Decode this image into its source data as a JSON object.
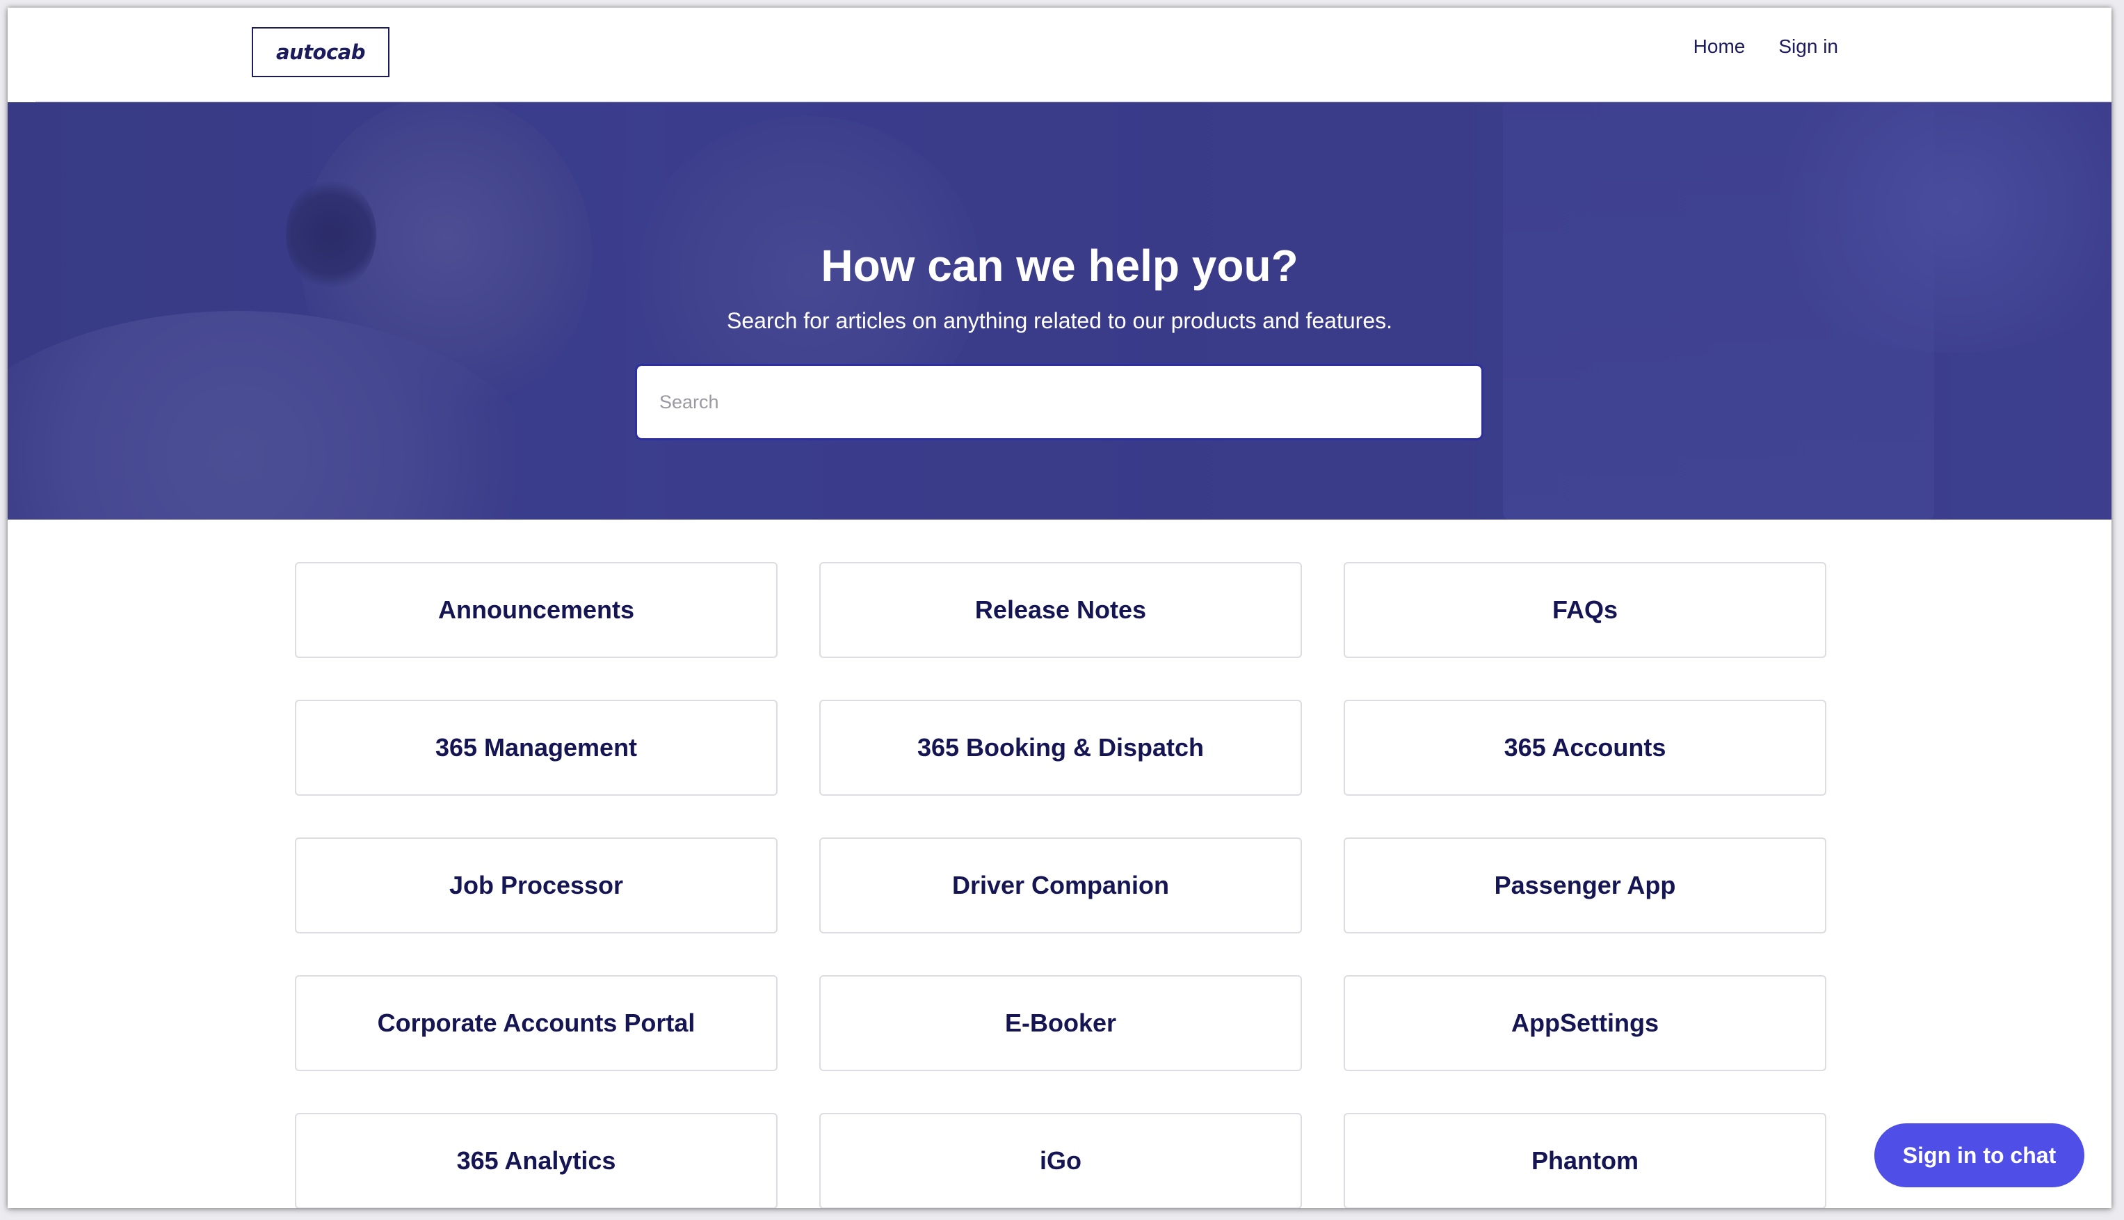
{
  "header": {
    "logo_text": "autocab",
    "nav": {
      "home": "Home",
      "sign_in": "Sign in"
    }
  },
  "hero": {
    "title": "How can we help you?",
    "subtitle": "Search for articles on anything related to our products and features.",
    "search_placeholder": "Search"
  },
  "categories": [
    "Announcements",
    "Release Notes",
    "FAQs",
    "365 Management",
    "365 Booking & Dispatch",
    "365 Accounts",
    "Job Processor",
    "Driver Companion",
    "Passenger App",
    "Corporate Accounts Portal",
    "E-Booker",
    "AppSettings",
    "365 Analytics",
    "iGo",
    "Phantom"
  ],
  "chat": {
    "label": "Sign in to chat"
  },
  "colors": {
    "brand_navy": "#1b1b5e",
    "hero_overlay": "#3f4288",
    "chat_button": "#4f4ee6"
  }
}
